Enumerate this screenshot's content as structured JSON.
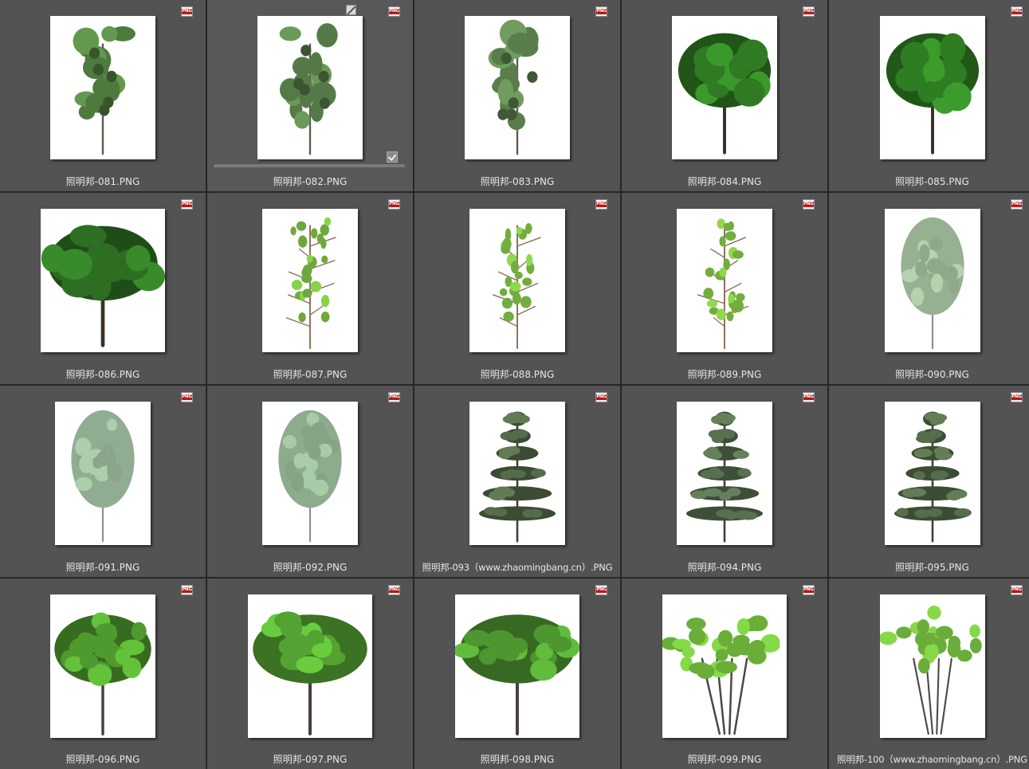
{
  "gallery": {
    "badge_text": "PNG",
    "items": [
      {
        "name": "照明邦-081.PNG",
        "style": "tall-sparse",
        "leaf": "#4f7a3e",
        "thumb": "portrait"
      },
      {
        "name": "照明邦-082.PNG",
        "style": "tall-sparse",
        "leaf": "#557a48",
        "thumb": "portrait",
        "selected": true
      },
      {
        "name": "照明邦-083.PNG",
        "style": "tall-sparse",
        "leaf": "#5a7d4c",
        "thumb": "portrait"
      },
      {
        "name": "照明邦-084.PNG",
        "style": "round-dense",
        "leaf": "#2f7a22",
        "thumb": "portrait"
      },
      {
        "name": "照明邦-085.PNG",
        "style": "round-dense",
        "leaf": "#2f7d22",
        "thumb": "portrait"
      },
      {
        "name": "照明邦-086.PNG",
        "style": "round-dense",
        "leaf": "#2d6e22",
        "thumb": "landscape"
      },
      {
        "name": "照明邦-087.PNG",
        "style": "sapling",
        "leaf": "#6ea83c",
        "thumb": "narrow"
      },
      {
        "name": "照明邦-088.PNG",
        "style": "sapling",
        "leaf": "#72ad3f",
        "thumb": "narrow"
      },
      {
        "name": "照明邦-089.PNG",
        "style": "sapling",
        "leaf": "#73ad3e",
        "thumb": "narrow"
      },
      {
        "name": "照明邦-090.PNG",
        "style": "oval",
        "leaf": "#8fa88a",
        "thumb": "narrow"
      },
      {
        "name": "照明邦-091.PNG",
        "style": "oval",
        "leaf": "#8aa58a",
        "thumb": "narrow"
      },
      {
        "name": "照明邦-092.PNG",
        "style": "oval",
        "leaf": "#86a386",
        "thumb": "narrow"
      },
      {
        "name": "照明邦-093（www.zhaomingbang.cn）.PNG",
        "style": "pine",
        "leaf": "#556b4a",
        "thumb": "narrow"
      },
      {
        "name": "照明邦-094.PNG",
        "style": "pine",
        "leaf": "#587050",
        "thumb": "narrow"
      },
      {
        "name": "照明邦-095.PNG",
        "style": "pine",
        "leaf": "#566d4c",
        "thumb": "narrow"
      },
      {
        "name": "照明邦-096.PNG",
        "style": "spread",
        "leaf": "#4f9a2e",
        "thumb": "portrait"
      },
      {
        "name": "照明邦-097.PNG",
        "style": "spread",
        "leaf": "#54a332",
        "thumb": "landscape"
      },
      {
        "name": "照明邦-098.PNG",
        "style": "spread",
        "leaf": "#4e9630",
        "thumb": "landscape"
      },
      {
        "name": "照明邦-099.PNG",
        "style": "multi",
        "leaf": "#6aae39",
        "thumb": "landscape"
      },
      {
        "name": "照明邦-100（www.zhaomingbang.cn）.PNG",
        "style": "multi",
        "leaf": "#6bad3a",
        "thumb": "portrait"
      }
    ]
  }
}
